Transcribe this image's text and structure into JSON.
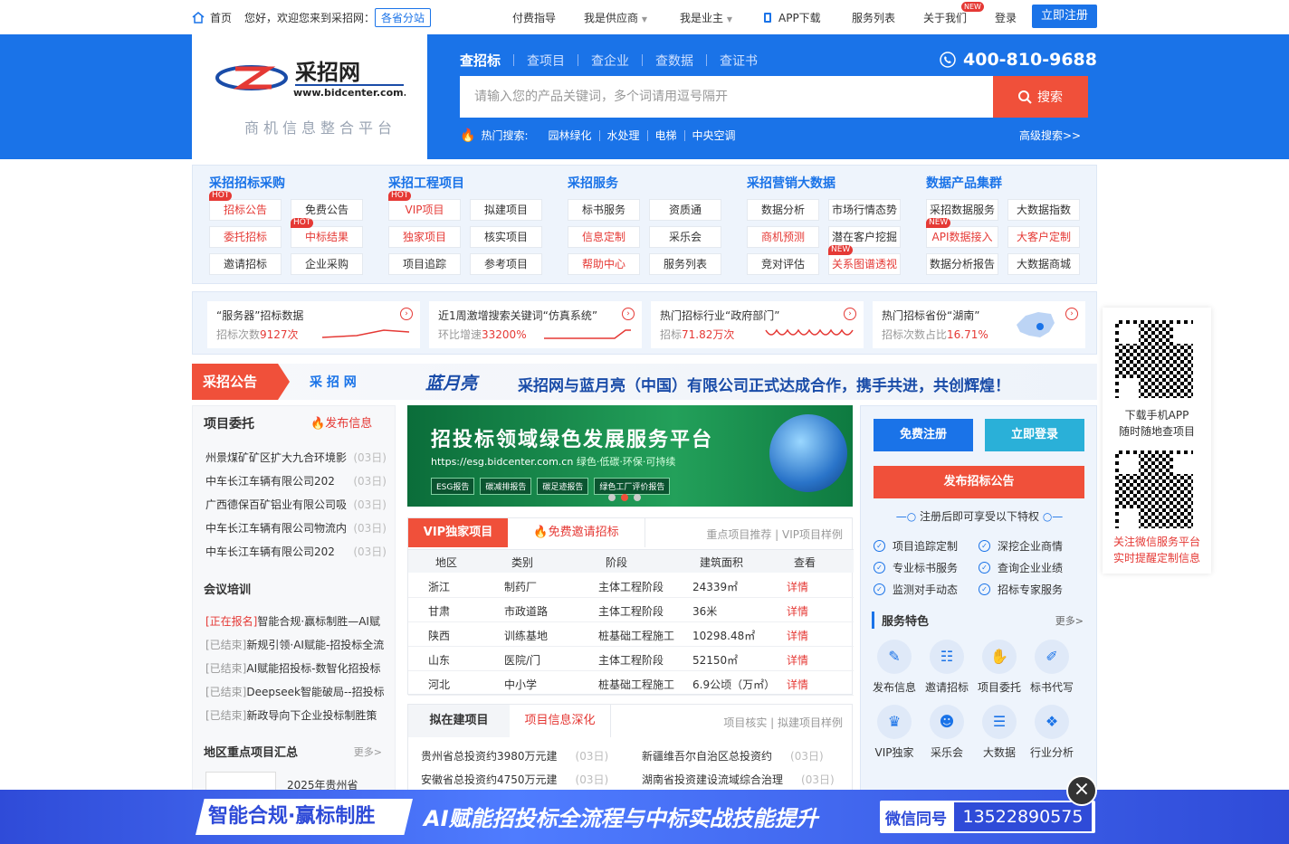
{
  "topbar": {
    "home": "首页",
    "welcome": "您好，欢迎您来到采招网：",
    "branch": "各省分站",
    "nav": [
      "付费指导",
      "我是供应商",
      "我是业主",
      "APP下载",
      "服务列表",
      "关于我们",
      "登录"
    ],
    "new_badge": "NEW",
    "register": "立即注册"
  },
  "logo": {
    "name": "采招网",
    "url": "www.bidcenter.com.cn",
    "slogan": "商机信息整合平台"
  },
  "search": {
    "tabs": [
      "查招标",
      "查项目",
      "查企业",
      "查数据",
      "查证书"
    ],
    "phone": "400-810-9688",
    "placeholder": "请输入您的产品关键词，多个词请用逗号隔开",
    "button": "搜索",
    "hot_label": "热门搜索:",
    "hot": [
      "园林绿化",
      "水处理",
      "电梯",
      "中央空调"
    ],
    "advanced": "高级搜索>>"
  },
  "categories": [
    {
      "title": "采招招标采购",
      "items": [
        {
          "label": "招标公告",
          "red": true,
          "tag": "HOT"
        },
        {
          "label": "免费公告"
        },
        {
          "label": "委托招标",
          "red": true
        },
        {
          "label": "中标结果",
          "red": true,
          "tag": "HOT"
        },
        {
          "label": "邀请招标"
        },
        {
          "label": "企业采购"
        }
      ]
    },
    {
      "title": "采招工程项目",
      "items": [
        {
          "label": "VIP项目",
          "red": true,
          "tag": "HOT"
        },
        {
          "label": "拟建项目"
        },
        {
          "label": "独家项目",
          "red": true
        },
        {
          "label": "核实项目"
        },
        {
          "label": "项目追踪"
        },
        {
          "label": "参考项目"
        }
      ]
    },
    {
      "title": "采招服务",
      "items": [
        {
          "label": "标书服务"
        },
        {
          "label": "资质通"
        },
        {
          "label": "信息定制",
          "red": true
        },
        {
          "label": "采乐会"
        },
        {
          "label": "帮助中心",
          "red": true
        },
        {
          "label": "服务列表"
        }
      ]
    },
    {
      "title": "采招营销大数据",
      "items": [
        {
          "label": "数据分析"
        },
        {
          "label": "市场行情态势"
        },
        {
          "label": "商机预测",
          "red": true
        },
        {
          "label": "潜在客户挖掘"
        },
        {
          "label": "竞对评估"
        },
        {
          "label": "关系图谱透视",
          "red": true,
          "tag": "NEW"
        }
      ]
    },
    {
      "title": "数据产品集群",
      "items": [
        {
          "label": "采招数据服务"
        },
        {
          "label": "大数据指数"
        },
        {
          "label": "API数据接入",
          "red": true,
          "tag": "NEW"
        },
        {
          "label": "大客户定制",
          "red": true
        },
        {
          "label": "数据分析报告"
        },
        {
          "label": "大数据商城"
        }
      ]
    }
  ],
  "stats": [
    {
      "title": "“服务器”招标数据",
      "pre": "招标次数",
      "val": "9127次",
      "post": ""
    },
    {
      "title": "近1周激增搜索关键词“仿真系统”",
      "pre": "环比增速",
      "val": "33200%",
      "post": ""
    },
    {
      "title": "热门招标行业“政府部门”",
      "pre": "招标",
      "val": "71.82万次",
      "post": ""
    },
    {
      "title": "热门招标省份“湖南”",
      "pre": "招标次数占比",
      "val": "16.71%",
      "post": ""
    }
  ],
  "banner": {
    "label": "采招公告",
    "logo_text": "采 招 网",
    "moon": "蓝月亮",
    "text": "采招网与蓝月亮（中国）有限公司正式达成合作，携手共进，共创辉煌！"
  },
  "left": {
    "proj_title": "项目委托",
    "publish": "发布信息",
    "projects": [
      {
        "t": "州景煤矿矿区扩大九合环境影",
        "d": "(03日)"
      },
      {
        "t": "中车长江车辆有限公司202",
        "d": "(03日)"
      },
      {
        "t": "广西德保百矿铝业有限公司吸",
        "d": "(03日)"
      },
      {
        "t": "中车长江车辆有限公司物流内",
        "d": "(03日)"
      },
      {
        "t": "中车长江车辆有限公司202",
        "d": "(03日)"
      }
    ],
    "meet_title": "会议培训",
    "meetings": [
      {
        "s": "[正在报名]",
        "t": "智能合规·赢标制胜—AI赋",
        "red": true
      },
      {
        "s": "[已结束]",
        "t": "新规引领·AI赋能-招投标全流"
      },
      {
        "s": "[已结束]",
        "t": "AI赋能招投标-数智化招投标"
      },
      {
        "s": "[已结束]",
        "t": "Deepseek智能破局--招投标"
      },
      {
        "s": "[已结束]",
        "t": "新政导向下企业投标制胜策"
      }
    ],
    "region_title": "地区重点项目汇总",
    "more": "更多>",
    "region_item": "2025年贵州省"
  },
  "hero": {
    "title": "招投标领域绿色发展服务平台",
    "url": "https://esg.bidcenter.com.cn",
    "sub": "绿色·低碳·环保·可持续",
    "pills": [
      "ESG报告",
      "碳减排报告",
      "碳足迹报告",
      "绿色工厂评价报告"
    ]
  },
  "vip": {
    "tab1": "VIP独家项目",
    "tab2": "免费邀请招标",
    "rec": "重点项目推荐 | VIP项目样例",
    "headers": [
      "地区",
      "类别",
      "阶段",
      "建筑面积",
      "查看"
    ],
    "rows": [
      [
        "浙江",
        "制药厂",
        "主体工程阶段",
        "24339㎡",
        "详情"
      ],
      [
        "甘肃",
        "市政道路",
        "主体工程阶段",
        "36米",
        "详情"
      ],
      [
        "陕西",
        "训练基地",
        "桩基础工程施工",
        "10298.48㎡",
        "详情"
      ],
      [
        "山东",
        "医院/门",
        "主体工程阶段",
        "52150㎡",
        "详情"
      ],
      [
        "河北",
        "中小学",
        "桩基础工程施工",
        "6.9公顷（万㎡）",
        "详情"
      ]
    ]
  },
  "build": {
    "tab1": "拟在建项目",
    "tab2": "项目信息深化",
    "rec": "项目核实 | 拟建项目样例",
    "items": [
      {
        "t": "贵州省总投资约3980万元建",
        "d": "(03日)"
      },
      {
        "t": "新疆维吾尔自治区总投资约",
        "d": "(03日)"
      },
      {
        "t": "安徽省总投资约4750万元建",
        "d": "(03日)"
      },
      {
        "t": "湖南省投资建设流域综合治理",
        "d": "(03日)"
      }
    ]
  },
  "right": {
    "free_reg": "免费注册",
    "login": "立即登录",
    "publish": "发布招标公告",
    "privilege": "注册后即可享受以下特权",
    "checks": [
      "项目追踪定制",
      "深挖企业商情",
      "专业标书服务",
      "查询企业业绩",
      "监测对手动态",
      "招标专家服务"
    ],
    "svc_title": "服务特色",
    "svc_more": "更多>",
    "icons": [
      {
        "l": "发布信息",
        "i": "pen-icon",
        "g": "✎"
      },
      {
        "l": "邀请招标",
        "i": "user-card-icon",
        "g": "☷"
      },
      {
        "l": "项目委托",
        "i": "handshake-icon",
        "g": "✋"
      },
      {
        "l": "标书代写",
        "i": "edit-icon",
        "g": "✐"
      },
      {
        "l": "VIP独家",
        "i": "crown-icon",
        "g": "♛"
      },
      {
        "l": "采乐会",
        "i": "person-icon",
        "g": "☻"
      },
      {
        "l": "大数据",
        "i": "database-icon",
        "g": "☰"
      },
      {
        "l": "行业分析",
        "i": "cubes-icon",
        "g": "❖"
      }
    ]
  },
  "qr": {
    "app1": "下载手机APP",
    "app2": "随时随地查项目",
    "wx1": "关注微信服务平台",
    "wx2": "实时提醒定制信息"
  },
  "bottom": {
    "left": "智能合规·赢标制胜",
    "main": "AI赋能招投标全流程与中标实战技能提升",
    "wx": "微信同号",
    "num": "13522890575",
    "close": "×"
  }
}
